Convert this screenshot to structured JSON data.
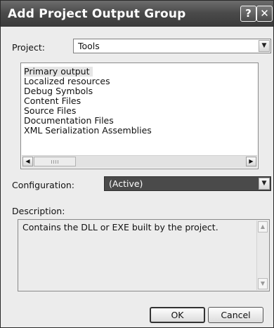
{
  "window": {
    "title": "Add Project Output Group",
    "help_glyph": "?",
    "close_glyph": "✕"
  },
  "project": {
    "label": "Project:",
    "value": "Tools"
  },
  "output_list": {
    "items": [
      "Primary output",
      "Localized resources",
      "Debug Symbols",
      "Content Files",
      "Source Files",
      "Documentation Files",
      "XML Serialization Assemblies"
    ],
    "selected_index": 0
  },
  "configuration": {
    "label": "Configuration:",
    "value": "(Active)"
  },
  "description": {
    "label": "Description:",
    "text": "Contains the DLL or EXE built by the project."
  },
  "buttons": {
    "ok": "OK",
    "cancel": "Cancel"
  },
  "colors": {
    "title_bar": "#4b4b4b",
    "selected_combo": "#4a4a4a",
    "dialog_bg": "#ececec"
  }
}
